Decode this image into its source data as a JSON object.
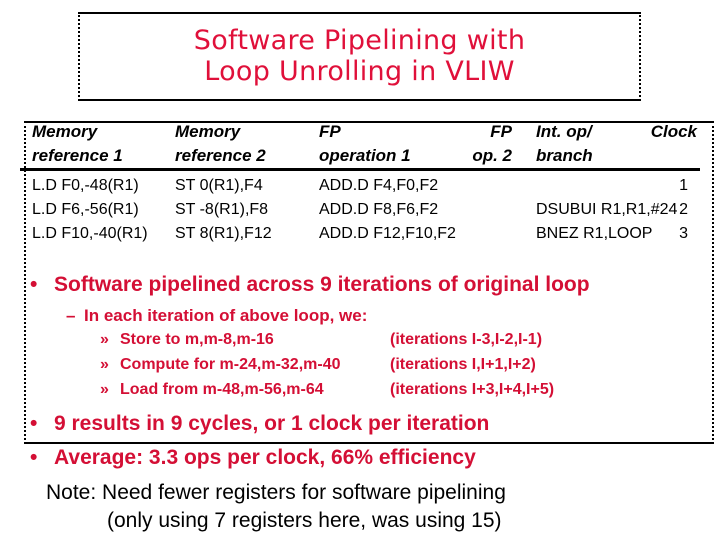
{
  "title": {
    "line1": "Software Pipelining with",
    "line2": "Loop Unrolling in VLIW"
  },
  "table": {
    "headers": [
      {
        "line1": "Memory",
        "line2": "reference 1"
      },
      {
        "line1": "Memory",
        "line2": "reference 2"
      },
      {
        "line1": "FP",
        "line2": "operation 1"
      },
      {
        "line1": "FP",
        "line2": "op. 2"
      },
      {
        "line1": "Int. op/",
        "line2": "branch"
      },
      {
        "line1": "Clock",
        "line2": ""
      }
    ],
    "rows": [
      {
        "mem1": "L.D F0,-48(R1)",
        "mem2": "ST 0(R1),F4",
        "fp1": "ADD.D F4,F0,F2",
        "fp2": "",
        "int": "",
        "clock": "1"
      },
      {
        "mem1": "L.D F6,-56(R1)",
        "mem2": "ST -8(R1),F8",
        "fp1": "ADD.D F8,F6,F2",
        "fp2": "",
        "int": "DSUBUI R1,R1,#24",
        "clock": "2"
      },
      {
        "mem1": "L.D F10,-40(R1)",
        "mem2": "ST 8(R1),F12",
        "fp1": "ADD.D F12,F10,F2",
        "fp2": "",
        "int": "BNEZ R1,LOOP",
        "clock": "3"
      }
    ]
  },
  "bullets": {
    "bullet_glyph": "•",
    "dash_glyph": "–",
    "sub_glyph": "»",
    "main1": "Software pipelined across 9 iterations of original loop",
    "sub1": "In each iteration of above loop, we:",
    "items": [
      {
        "action": "Store to m,m-8,m-16",
        "iterations": "(iterations I-3,I-2,I-1)"
      },
      {
        "action": "Compute for m-24,m-32,m-40",
        "iterations": "(iterations I,I+1,I+2)"
      },
      {
        "action": "Load from m-48,m-56,m-64",
        "iterations": "(iterations I+3,I+4,I+5)"
      }
    ],
    "main2": "9 results in 9 cycles, or 1 clock per iteration",
    "main3": "Average: 3.3 ops per clock, 66% efficiency"
  },
  "note": {
    "line1": "Note: Need fewer registers for software pipelining",
    "line2": "(only using 7 registers here, was using 15)"
  },
  "colors": {
    "title": "#e0103a",
    "bullet_text": "#d40f35",
    "body_text": "#000000"
  }
}
